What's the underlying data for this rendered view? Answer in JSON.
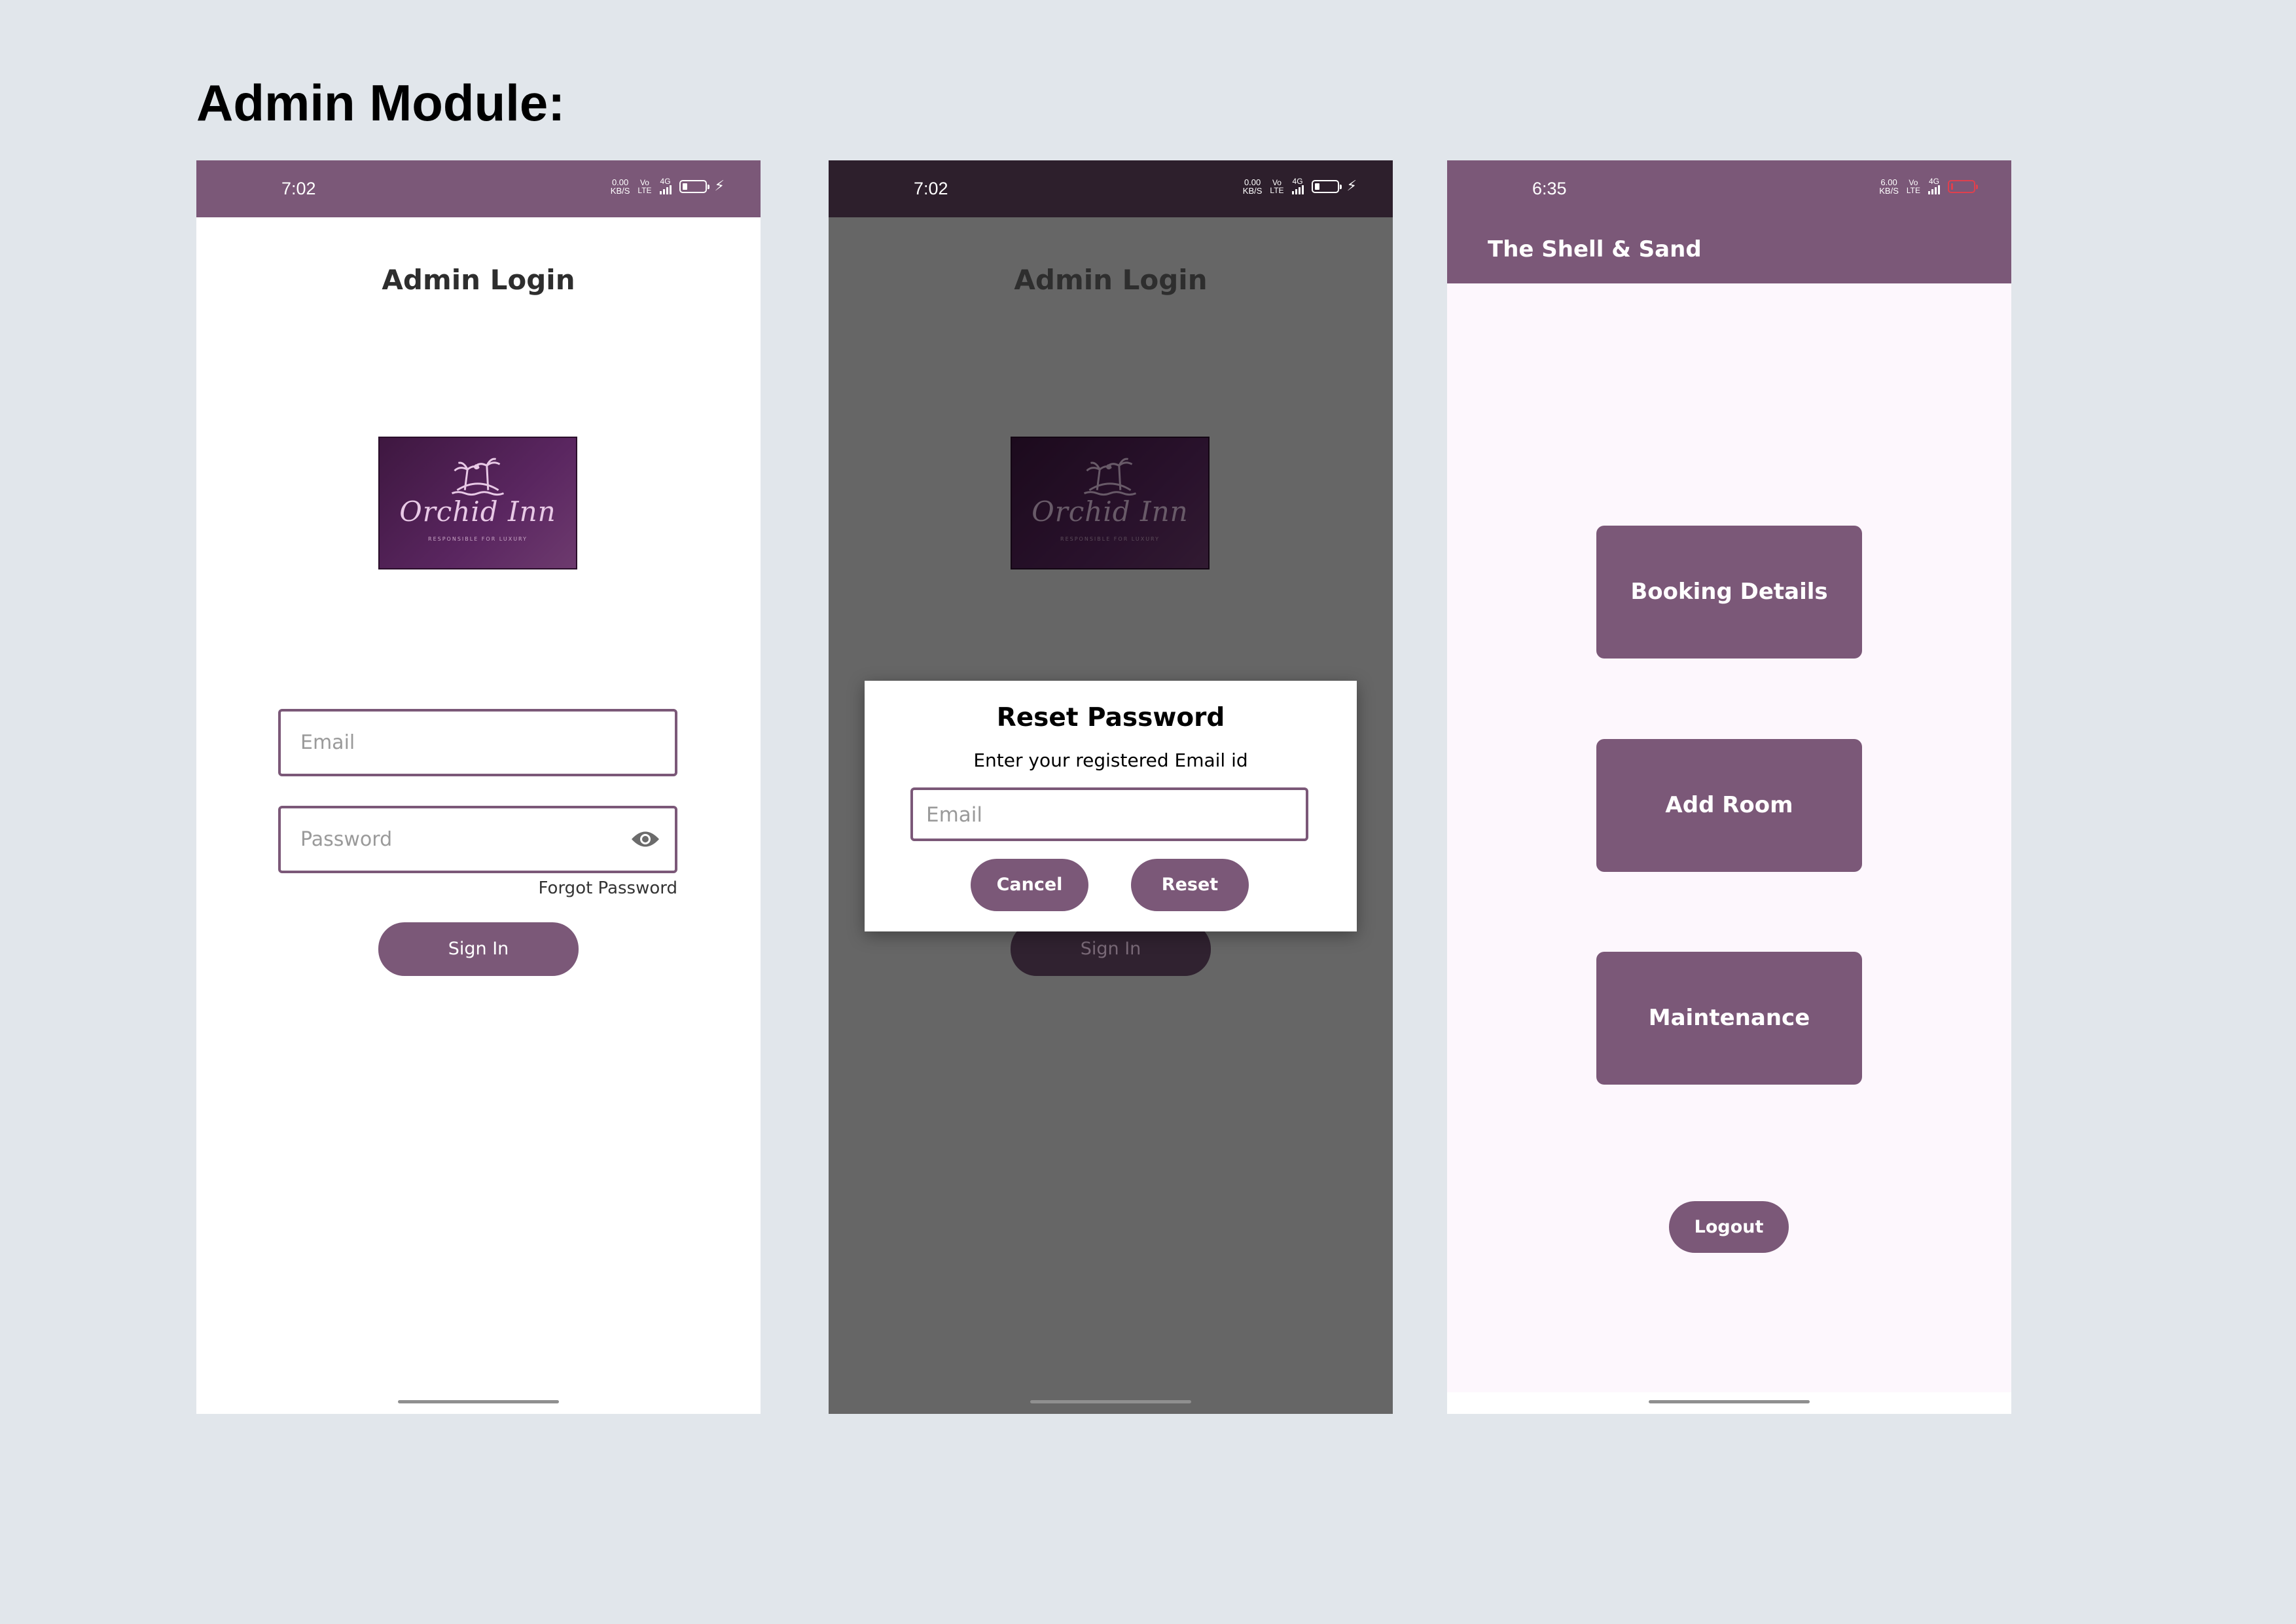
{
  "heading": "Admin Module:",
  "screen1": {
    "status_time": "7:02",
    "net_speed_top": "0.00",
    "net_speed_bottom": "KB/S",
    "signal_label": "4G",
    "volte_top": "Vo",
    "volte_bottom": "LTE",
    "title": "Admin Login",
    "logo": {
      "name": "Orchid Inn",
      "tagline": "RESPONSIBLE FOR LUXURY"
    },
    "email_placeholder": "Email",
    "password_placeholder": "Password",
    "forgot_password": "Forgot Password",
    "sign_in": "Sign In"
  },
  "screen2": {
    "status_time": "7:02",
    "net_speed_top": "0.00",
    "net_speed_bottom": "KB/S",
    "signal_label": "4G",
    "volte_top": "Vo",
    "volte_bottom": "LTE",
    "title": "Admin Login",
    "logo": {
      "name": "Orchid Inn",
      "tagline": "RESPONSIBLE FOR LUXURY"
    },
    "sign_in": "Sign In",
    "dialog": {
      "title": "Reset Password",
      "subtitle": "Enter your registered Email id",
      "email_placeholder": "Email",
      "cancel": "Cancel",
      "reset": "Reset"
    }
  },
  "screen3": {
    "status_time": "6:35",
    "net_speed_top": "6.00",
    "net_speed_bottom": "KB/S",
    "signal_label": "4G",
    "volte_top": "Vo",
    "volte_bottom": "LTE",
    "app_title": "The Shell & Sand",
    "buttons": [
      "Booking Details",
      "Add Room",
      "Maintenance"
    ],
    "logout": "Logout"
  },
  "colors": {
    "primary": "#7b5878",
    "page_background": "#e1e6eb",
    "dim_overlay": "#666666",
    "dashboard_background": "#fdf7fd",
    "battery_low": "#e0404e"
  }
}
